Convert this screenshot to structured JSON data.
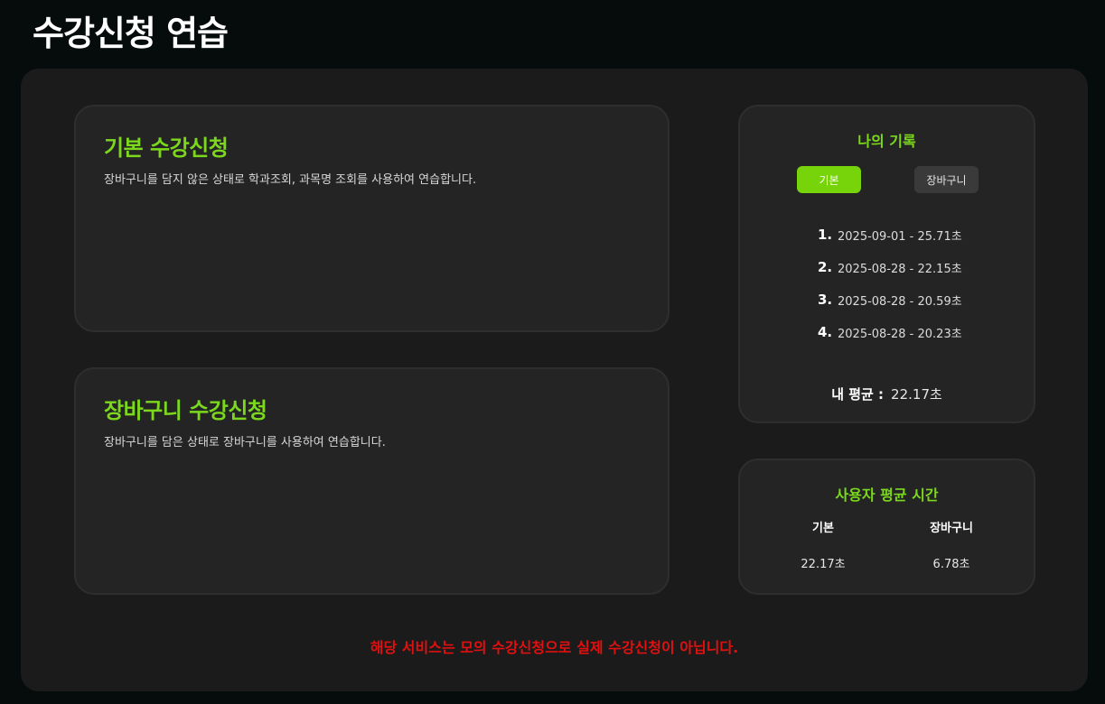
{
  "page": {
    "title": "수강신청 연습"
  },
  "modes": {
    "basic": {
      "title": "기본 수강신청",
      "description": "장바구니를 담지 않은 상태로 학과조회, 과목명 조회를 사용하여 연습합니다."
    },
    "cart": {
      "title": "장바구니 수강신청",
      "description": "장바구니를 담은 상태로 장바구니를 사용하여 연습합니다."
    }
  },
  "records": {
    "title": "나의 기록",
    "tabs": {
      "basic": "기본",
      "cart": "장바구니"
    },
    "active_tab": "basic",
    "items": [
      {
        "rank": "1.",
        "text": "2025-09-01 - 25.71초"
      },
      {
        "rank": "2.",
        "text": "2025-08-28 - 22.15초"
      },
      {
        "rank": "3.",
        "text": "2025-08-28 - 20.59초"
      },
      {
        "rank": "4.",
        "text": "2025-08-28 - 20.23초"
      }
    ],
    "average_label": "내 평균 :",
    "average_value": "22.17초"
  },
  "user_average": {
    "title": "사용자 평균 시간",
    "columns": [
      {
        "header": "기본",
        "value": "22.17초"
      },
      {
        "header": "장바구니",
        "value": "6.78초"
      }
    ]
  },
  "disclaimer": "해당 서비스는 모의 수강신청으로 실제 수강신청이 아닙니다.",
  "colors": {
    "accent": "#7bd81c",
    "active_tab": "#78d40a",
    "warning": "#e01010",
    "background": "#050c0b",
    "panel": "#1b1b1b",
    "card": "#242424"
  }
}
